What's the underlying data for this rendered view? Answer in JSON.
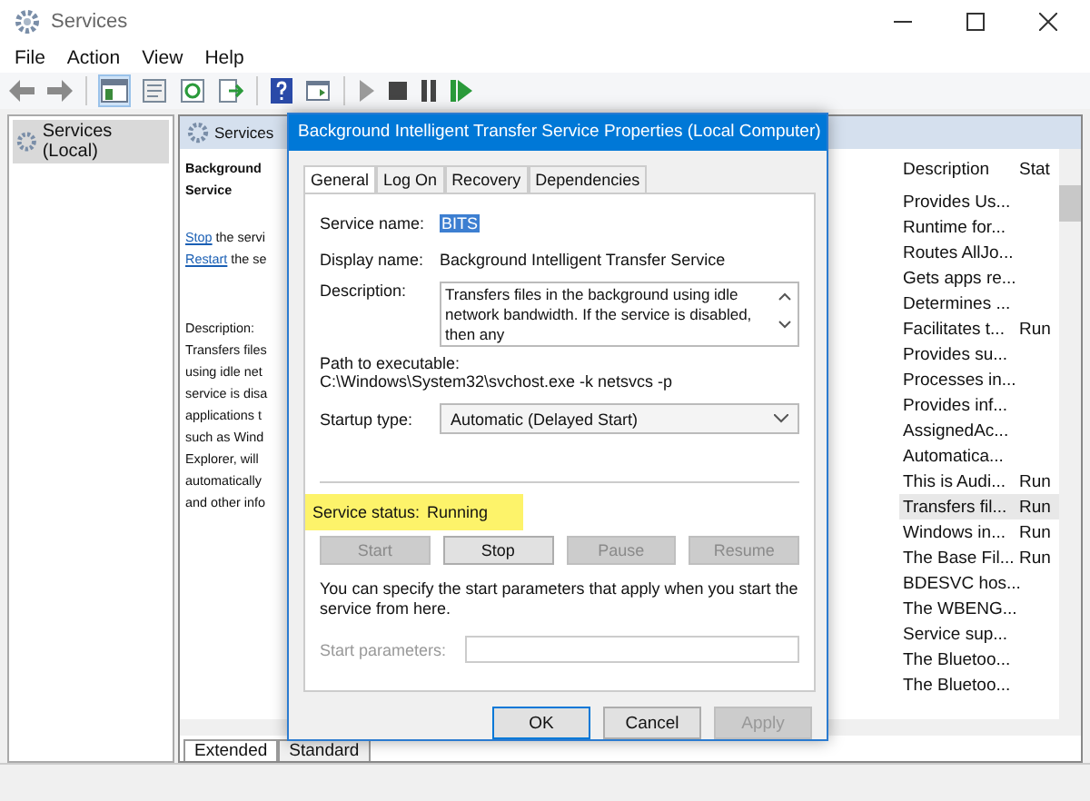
{
  "window": {
    "title": "Services"
  },
  "menu": [
    "File",
    "Action",
    "View",
    "Help"
  ],
  "toolbar": [
    {
      "kind": "back"
    },
    {
      "kind": "forward"
    },
    {
      "kind": "separator"
    },
    {
      "kind": "tree"
    },
    {
      "kind": "sheet"
    },
    {
      "kind": "refresh"
    },
    {
      "kind": "export"
    },
    {
      "kind": "separator"
    },
    {
      "kind": "help"
    },
    {
      "kind": "console"
    },
    {
      "kind": "separator"
    },
    {
      "kind": "play"
    },
    {
      "kind": "stop"
    },
    {
      "kind": "pause"
    },
    {
      "kind": "resume"
    }
  ],
  "tree": [
    {
      "label": "Services (Local)",
      "selected": true
    }
  ],
  "pane": {
    "title": "Services",
    "heading": [
      "Background",
      "Service"
    ],
    "links": [
      {
        "link": "Stop",
        "rest": "the servi"
      },
      {
        "link": "Restart",
        "rest": "the se"
      }
    ],
    "description_label": "Description:",
    "description_lines": [
      "Transfers files",
      "using idle net",
      "service is disa",
      "applications t",
      "such as Wind",
      "Explorer, will",
      "automatically",
      "and other info"
    ],
    "columns": [
      "Description",
      "Stat"
    ],
    "rows": [
      {
        "description": "Provides Us...",
        "selected": false
      },
      {
        "description": "Runtime for...",
        "selected": false
      },
      {
        "description": "Routes AllJo...",
        "selected": false
      },
      {
        "description": "Gets apps re...",
        "selected": false
      },
      {
        "description": "Determines ...",
        "selected": false
      },
      {
        "description": "Facilitates t...",
        "status": "Run",
        "selected": false
      },
      {
        "description": "Provides su...",
        "selected": false
      },
      {
        "description": "Processes in...",
        "selected": false
      },
      {
        "description": "Provides inf...",
        "selected": false
      },
      {
        "description": "AssignedAc...",
        "selected": false
      },
      {
        "description": "Automatica...",
        "selected": false
      },
      {
        "description": "This is Audi...",
        "status": "Run",
        "selected": false
      },
      {
        "description": "Transfers fil...",
        "status": "Run",
        "selected": true
      },
      {
        "description": "Windows in...",
        "status": "Run",
        "selected": false
      },
      {
        "description": "The Base Fil...",
        "status": "Run",
        "selected": false
      },
      {
        "description": "BDESVC hos...",
        "selected": false
      },
      {
        "description": "The WBENG...",
        "selected": false
      },
      {
        "description": "Service sup...",
        "selected": false
      },
      {
        "description": "The Bluetoo...",
        "selected": false
      },
      {
        "description": "The Bluetoo...",
        "selected": false
      }
    ],
    "bottom_tabs": [
      {
        "label": "Extended",
        "selected": true
      },
      {
        "label": "Standard",
        "selected": false
      }
    ]
  },
  "dialog": {
    "title": "Background Intelligent Transfer Service Properties (Local Computer)",
    "tabs": [
      {
        "label": "General",
        "selected": true
      },
      {
        "label": "Log On",
        "selected": false
      },
      {
        "label": "Recovery",
        "selected": false
      },
      {
        "label": "Dependencies",
        "selected": false
      }
    ],
    "service_name_label": "Service name:",
    "service_name": "BITS",
    "display_name_label": "Display name:",
    "display_name": "Background Intelligent Transfer Service",
    "description_label": "Description:",
    "description": "Transfers files in the background using idle network bandwidth. If the service is disabled, then any",
    "path_label": "Path to executable:",
    "path": "C:\\Windows\\System32\\svchost.exe -k netsvcs -p",
    "startup_label": "Startup type:",
    "startup": "Automatic (Delayed Start)",
    "status_label": "Service status:",
    "status": "Running",
    "control_buttons": [
      {
        "label": "Start",
        "disabled": true
      },
      {
        "label": "Stop",
        "disabled": false
      },
      {
        "label": "Pause",
        "disabled": true
      },
      {
        "label": "Resume",
        "disabled": true
      }
    ],
    "hint": "You can specify the start parameters that apply when you start the service from here.",
    "params_label": "Start parameters:",
    "footer_buttons": [
      {
        "label": "OK",
        "disabled": false,
        "default": true
      },
      {
        "label": "Cancel",
        "disabled": false,
        "default": false
      },
      {
        "label": "Apply",
        "disabled": true,
        "default": false
      }
    ]
  }
}
